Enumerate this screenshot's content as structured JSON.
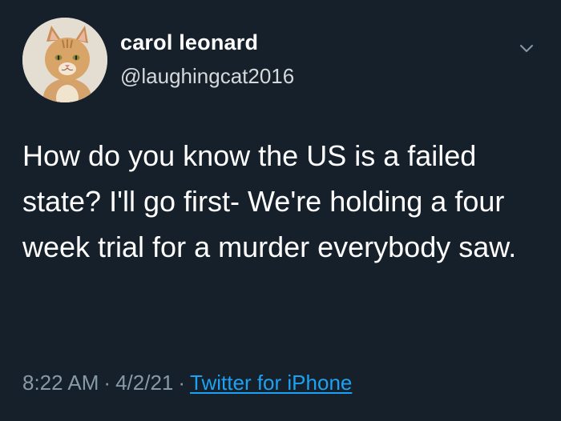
{
  "tweet": {
    "author_name": "carol leonard",
    "author_handle": "@laughingcat2016",
    "text": "How do you know the US is a failed state? I'll go first- We're holding a four week trial for a murder everybody saw.",
    "time": "8:22 AM",
    "date": "4/2/21",
    "separator": "·",
    "source": "Twitter for iPhone"
  },
  "icons": {
    "avatar": "orange-tabby-cat-avatar",
    "menu": "chevron-down-icon"
  },
  "colors": {
    "background": "#15202b",
    "text": "#ffffff",
    "muted": "#8899a6",
    "link": "#1da1f2"
  }
}
